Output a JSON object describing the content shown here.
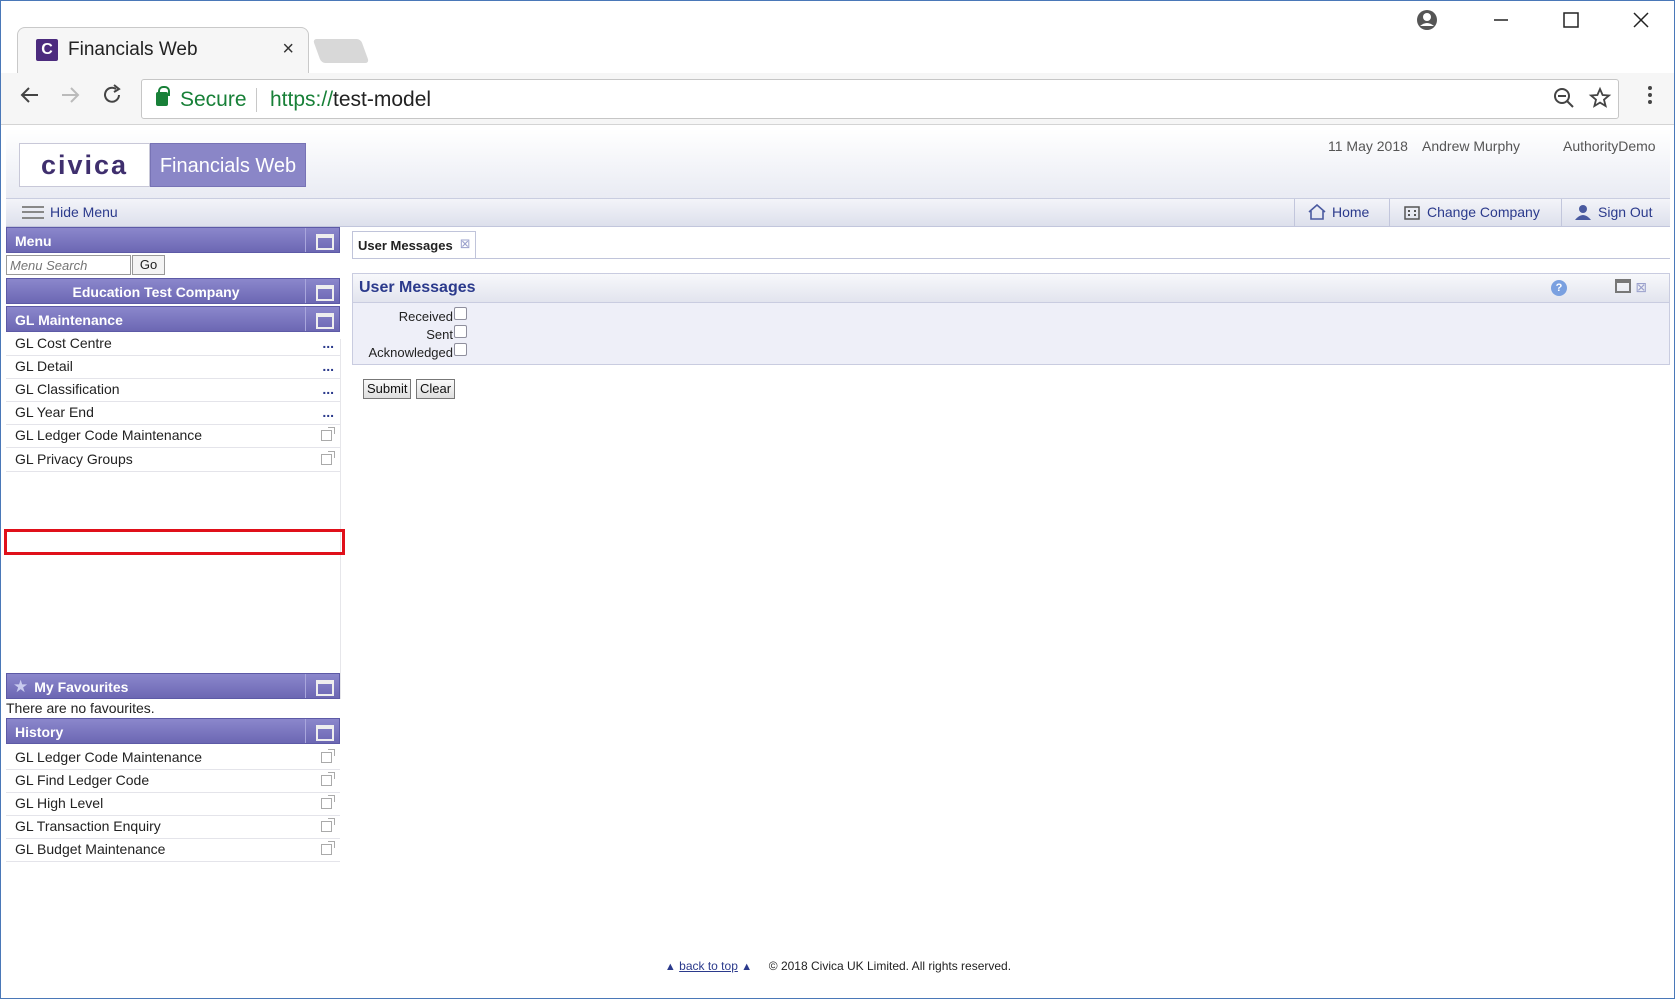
{
  "browser": {
    "tab_title": "Financials Web",
    "tab_close": "×",
    "favicon_letter": "C",
    "secure_label": "Secure",
    "url_scheme": "https://",
    "url_host": "test-model"
  },
  "header": {
    "logo": "civica",
    "product": "Financials Web",
    "date": "11 May 2018",
    "user": "Andrew Murphy",
    "authority": "AuthorityDemo"
  },
  "menubar": {
    "hide_menu": "Hide Menu",
    "home": "Home",
    "change_company": "Change Company",
    "sign_out": "Sign Out"
  },
  "menu": {
    "title": "Menu",
    "search_placeholder": "Menu Search",
    "go": "Go",
    "company": "Education Test Company",
    "section": "GL Maintenance",
    "items": [
      {
        "label": "GL Cost Centre",
        "marker": "..."
      },
      {
        "label": "GL Detail",
        "marker": "..."
      },
      {
        "label": "GL Classification",
        "marker": "..."
      },
      {
        "label": "GL Year End",
        "marker": "..."
      },
      {
        "label": "GL Ledger Code Maintenance",
        "marker": "ext"
      },
      {
        "label": "GL Privacy Groups",
        "marker": "ext"
      }
    ]
  },
  "favourites": {
    "title": "My Favourites",
    "empty": "There are no favourites."
  },
  "history": {
    "title": "History",
    "items": [
      "GL Ledger Code Maintenance",
      "GL Find Ledger Code",
      "GL High Level",
      "GL Transaction Enquiry",
      "GL Budget Maintenance"
    ]
  },
  "content": {
    "tab": "User Messages",
    "section_title": "User Messages",
    "filters": {
      "received": "Received",
      "sent": "Sent",
      "acknowledged": "Acknowledged"
    },
    "submit": "Submit",
    "clear": "Clear"
  },
  "footer": {
    "back_to_top": "back to top",
    "copyright": "© 2018 Civica UK Limited. All rights reserved."
  },
  "colors": {
    "accent": "#6c67b3",
    "link": "#2b3a8c",
    "highlight": "#e0101a",
    "secure": "#188038"
  }
}
